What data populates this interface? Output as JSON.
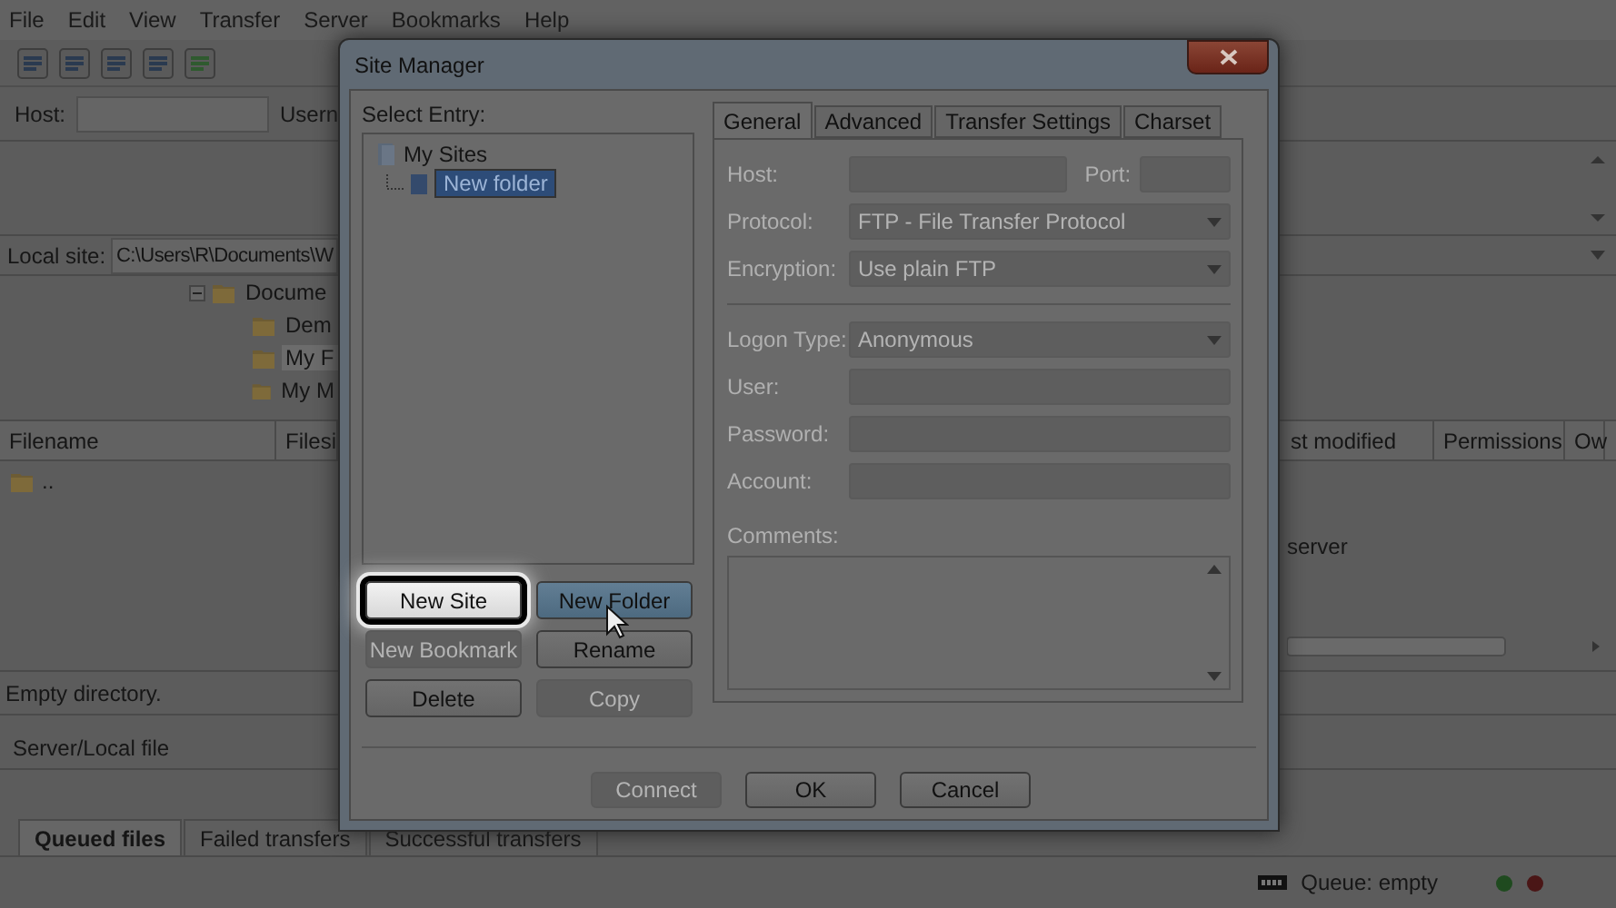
{
  "menu": [
    "File",
    "Edit",
    "View",
    "Transfer",
    "Server",
    "Bookmarks",
    "Help"
  ],
  "quickconnect": {
    "host_label": "Host:",
    "username_label": "Usern"
  },
  "local_site": {
    "label": "Local site:",
    "path": "C:\\Users\\R\\Documents\\W"
  },
  "local_tree": [
    {
      "label": "Docume",
      "expanded": true,
      "selected": false,
      "children": [
        {
          "label": "Dem",
          "selected": false
        },
        {
          "label": "My F",
          "selected": true
        },
        {
          "label": "My M",
          "selected": false
        }
      ]
    }
  ],
  "local_files": {
    "columns": [
      "Filename",
      "Filesi"
    ],
    "rows": [
      ".."
    ],
    "status": "Empty directory."
  },
  "remote_files": {
    "columns": [
      "st modified",
      "Permissions",
      "Ow"
    ],
    "message": "server"
  },
  "queue": {
    "column": "Server/Local file",
    "tabs": [
      {
        "label": "Queued files",
        "selected": true
      },
      {
        "label": "Failed transfers",
        "selected": false
      },
      {
        "label": "Successful transfers",
        "selected": false
      }
    ]
  },
  "status_bar": {
    "queue": "Queue: empty"
  },
  "dialog": {
    "title": "Site Manager",
    "select_label": "Select Entry:",
    "tree": [
      {
        "label": "My Sites",
        "expanded": true,
        "selected": false,
        "children": [
          {
            "label": "New folder",
            "selected": true
          }
        ]
      }
    ],
    "entry_buttons": [
      {
        "label": "New Site",
        "disabled": false,
        "highlighted": true,
        "hovered": false
      },
      {
        "label": "New Folder",
        "disabled": false,
        "highlighted": false,
        "hovered": true
      },
      {
        "label": "New Bookmark",
        "disabled": true,
        "highlighted": false,
        "hovered": false
      },
      {
        "label": "Rename",
        "disabled": false,
        "highlighted": false,
        "hovered": false
      },
      {
        "label": "Delete",
        "disabled": false,
        "highlighted": false,
        "hovered": false
      },
      {
        "label": "Copy",
        "disabled": true,
        "highlighted": false,
        "hovered": false
      }
    ],
    "tabs": [
      {
        "label": "General",
        "selected": true
      },
      {
        "label": "Advanced",
        "selected": false
      },
      {
        "label": "Transfer Settings",
        "selected": false
      },
      {
        "label": "Charset",
        "selected": false
      }
    ],
    "form_disabled": true,
    "host_label": "Host:",
    "port_label": "Port:",
    "protocol": {
      "label": "Protocol:",
      "value": "FTP - File Transfer Protocol"
    },
    "encryption": {
      "label": "Encryption:",
      "value": "Use plain FTP"
    },
    "logon_type": {
      "label": "Logon Type:",
      "value": "Anonymous"
    },
    "user_label": "User:",
    "password_label": "Password:",
    "account_label": "Account:",
    "comments_label": "Comments:",
    "footer_buttons": [
      {
        "label": "Connect",
        "disabled": true
      },
      {
        "label": "OK",
        "disabled": false
      },
      {
        "label": "Cancel",
        "disabled": false
      }
    ]
  }
}
